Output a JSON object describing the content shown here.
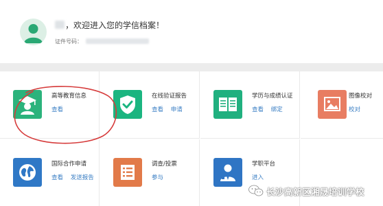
{
  "profile": {
    "welcome": "，欢迎进入您的学信档案！",
    "id_label": "证件号码："
  },
  "services": [
    {
      "title": "高等教育信息",
      "links": [
        "查看"
      ],
      "color": "#2bb37c",
      "icon": "graduate-icon"
    },
    {
      "title": "在线验证报告",
      "links": [
        "查看",
        "申请"
      ],
      "color": "#1bb580",
      "icon": "shield-check-icon"
    },
    {
      "title": "学历与成绩认证",
      "links": [
        "查看",
        "绑定"
      ],
      "color": "#20b07f",
      "icon": "open-book-icon"
    },
    {
      "title": "图像校对",
      "links": [
        "校对"
      ],
      "color": "#e87d62",
      "icon": "image-icon"
    },
    {
      "title": "国际合作申请",
      "links": [
        "查看",
        "发送报告"
      ],
      "color": "#2f78c6",
      "icon": "globe-icon"
    },
    {
      "title": "调查/投票",
      "links": [
        "参与"
      ],
      "color": "#e27a49",
      "icon": "survey-list-icon"
    },
    {
      "title": "学职平台",
      "links": [
        "进入"
      ],
      "color": "#2f75c4",
      "icon": "career-person-icon"
    }
  ],
  "annotation_color": "#d63b3b",
  "watermark": {
    "text": "长沙高新区湘晟培训学校"
  }
}
